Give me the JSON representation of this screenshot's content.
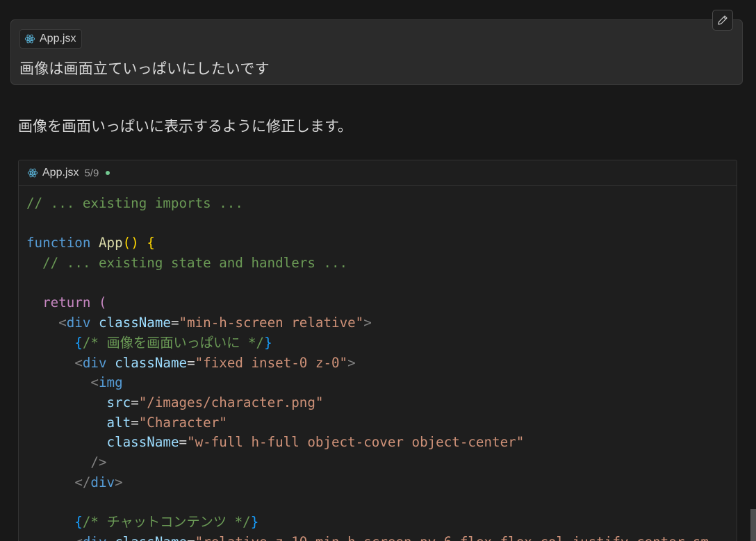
{
  "user_message": {
    "attachment_label": "App.jsx",
    "attachment_icon": "react-icon",
    "text": "画像は画面立ていっぱいにしたいです",
    "edit_icon": "pencil-icon"
  },
  "assistant": {
    "reply": "画像を画面いっぱいに表示するように修正します。"
  },
  "code_block": {
    "file_label": "App.jsx",
    "position": "5/9",
    "status_color": "#73c991",
    "lines": [
      [
        {
          "t": "comment",
          "v": "// ... existing imports ..."
        }
      ],
      [],
      [
        {
          "t": "keyword",
          "v": "function"
        },
        {
          "t": "plain",
          "v": " "
        },
        {
          "t": "fn",
          "v": "App"
        },
        {
          "t": "paren",
          "v": "()"
        },
        {
          "t": "plain",
          "v": " "
        },
        {
          "t": "paren",
          "v": "{"
        }
      ],
      [
        {
          "t": "plain",
          "v": "  "
        },
        {
          "t": "comment",
          "v": "// ... existing state and handlers ..."
        }
      ],
      [],
      [
        {
          "t": "plain",
          "v": "  "
        },
        {
          "t": "control",
          "v": "return"
        },
        {
          "t": "plain",
          "v": " "
        },
        {
          "t": "control",
          "v": "("
        }
      ],
      [
        {
          "t": "plain",
          "v": "    "
        },
        {
          "t": "tagpunct",
          "v": "<"
        },
        {
          "t": "tag",
          "v": "div"
        },
        {
          "t": "plain",
          "v": " "
        },
        {
          "t": "attr",
          "v": "className"
        },
        {
          "t": "plain",
          "v": "="
        },
        {
          "t": "str",
          "v": "\"min-h-screen relative\""
        },
        {
          "t": "tagpunct",
          "v": ">"
        }
      ],
      [
        {
          "t": "plain",
          "v": "      "
        },
        {
          "t": "brace",
          "v": "{"
        },
        {
          "t": "comment",
          "v": "/* 画像を画面いっぱいに */"
        },
        {
          "t": "brace",
          "v": "}"
        }
      ],
      [
        {
          "t": "plain",
          "v": "      "
        },
        {
          "t": "tagpunct",
          "v": "<"
        },
        {
          "t": "tag",
          "v": "div"
        },
        {
          "t": "plain",
          "v": " "
        },
        {
          "t": "attr",
          "v": "className"
        },
        {
          "t": "plain",
          "v": "="
        },
        {
          "t": "str",
          "v": "\"fixed inset-0 z-0\""
        },
        {
          "t": "tagpunct",
          "v": ">"
        }
      ],
      [
        {
          "t": "plain",
          "v": "        "
        },
        {
          "t": "tagpunct",
          "v": "<"
        },
        {
          "t": "tag",
          "v": "img"
        }
      ],
      [
        {
          "t": "plain",
          "v": "          "
        },
        {
          "t": "attr",
          "v": "src"
        },
        {
          "t": "plain",
          "v": "="
        },
        {
          "t": "str",
          "v": "\"/images/character.png\""
        }
      ],
      [
        {
          "t": "plain",
          "v": "          "
        },
        {
          "t": "attr",
          "v": "alt"
        },
        {
          "t": "plain",
          "v": "="
        },
        {
          "t": "str",
          "v": "\"Character\""
        }
      ],
      [
        {
          "t": "plain",
          "v": "          "
        },
        {
          "t": "attr",
          "v": "className"
        },
        {
          "t": "plain",
          "v": "="
        },
        {
          "t": "str",
          "v": "\"w-full h-full object-cover object-center\""
        }
      ],
      [
        {
          "t": "plain",
          "v": "        "
        },
        {
          "t": "tagpunct",
          "v": "/>"
        }
      ],
      [
        {
          "t": "plain",
          "v": "      "
        },
        {
          "t": "tagpunct",
          "v": "</"
        },
        {
          "t": "tag",
          "v": "div"
        },
        {
          "t": "tagpunct",
          "v": ">"
        }
      ],
      [],
      [
        {
          "t": "plain",
          "v": "      "
        },
        {
          "t": "brace",
          "v": "{"
        },
        {
          "t": "comment",
          "v": "/* チャットコンテンツ */"
        },
        {
          "t": "brace",
          "v": "}"
        }
      ],
      [
        {
          "t": "plain",
          "v": "      "
        },
        {
          "t": "tagpunct",
          "v": "<"
        },
        {
          "t": "tag",
          "v": "div"
        },
        {
          "t": "plain",
          "v": " "
        },
        {
          "t": "attr",
          "v": "className"
        },
        {
          "t": "plain",
          "v": "="
        },
        {
          "t": "str",
          "v": "\"relative z-10 min-h-screen py-6 flex flex-col justify-center sm"
        }
      ]
    ]
  }
}
